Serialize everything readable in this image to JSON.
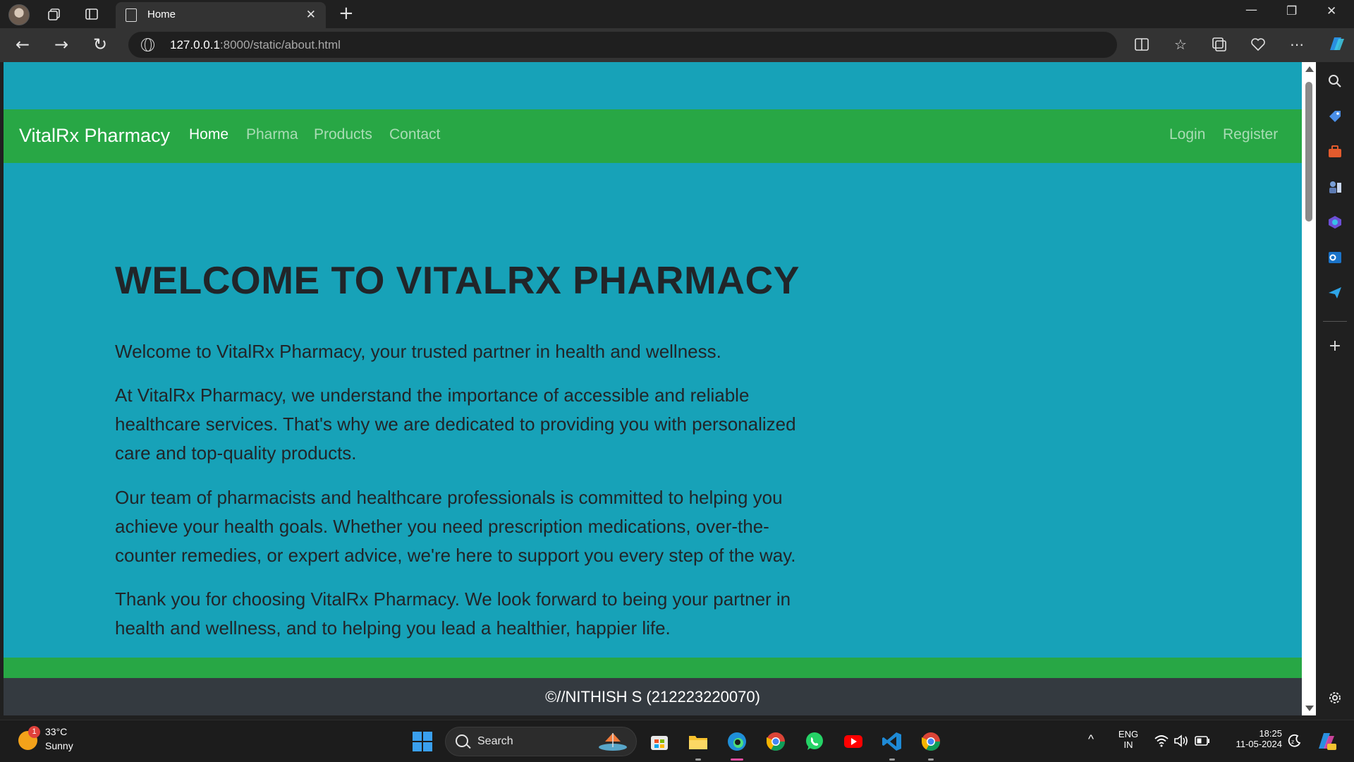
{
  "browser": {
    "tab_title": "Home",
    "url_host": "127.0.0.1",
    "url_path": ":8000/static/about.html"
  },
  "site": {
    "brand": "VitalRx Pharmacy",
    "nav": {
      "home": "Home",
      "pharma": "Pharma",
      "products": "Products",
      "contact": "Contact",
      "login": "Login",
      "register": "Register"
    },
    "heading": "WELCOME TO VITALRX PHARMACY",
    "paragraphs": [
      "Welcome to VitalRx Pharmacy, your trusted partner in health and wellness.",
      "At VitalRx Pharmacy, we understand the importance of accessible and reliable healthcare services. That's why we are dedicated to providing you with personalized care and top-quality products.",
      "Our team of pharmacists and healthcare professionals is committed to helping you achieve your health goals. Whether you need prescription medications, over-the-counter remedies, or expert advice, we're here to support you every step of the way.",
      "Thank you for choosing VitalRx Pharmacy. We look forward to being your partner in health and wellness, and to helping you lead a healthier, happier life."
    ],
    "footer": "©//NITHISH S (212223220070)",
    "colors": {
      "background": "#17a2b8",
      "navbar": "#28a745",
      "footer": "#343a40"
    }
  },
  "taskbar": {
    "weather_badge": "1",
    "temperature": "33°C",
    "condition": "Sunny",
    "search_label": "Search",
    "lang_top": "ENG",
    "lang_bottom": "IN",
    "time": "18:25",
    "date": "11-05-2024"
  }
}
